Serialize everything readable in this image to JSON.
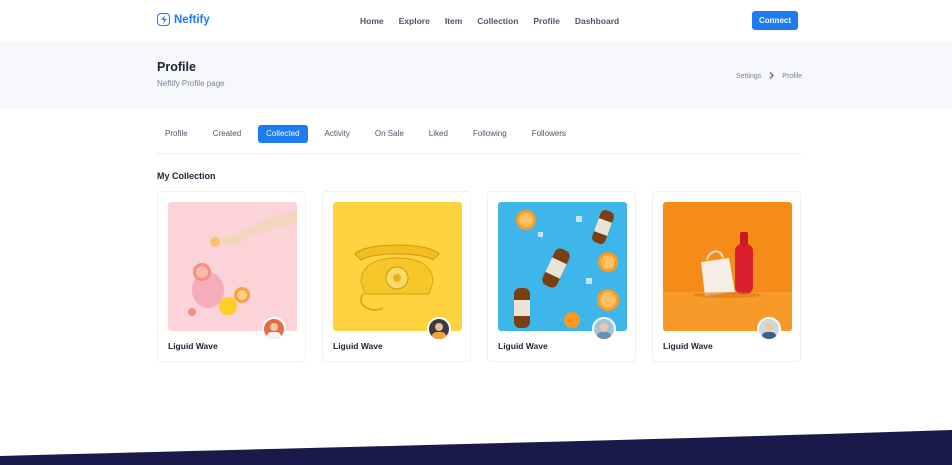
{
  "brand": {
    "name": "Neftify",
    "accent": "#1d7cf2"
  },
  "nav": {
    "links": [
      "Home",
      "Explore",
      "Item",
      "Collection",
      "Profile",
      "Dashboard"
    ],
    "connect_label": "Connect"
  },
  "hero": {
    "title": "Profile",
    "subtitle": "Neftify Profile page",
    "breadcrumb": [
      "Settings",
      "Profile"
    ]
  },
  "tabs": {
    "items": [
      "Profile",
      "Created",
      "Collected",
      "Activity",
      "On Sale",
      "Liked",
      "Following",
      "Followers"
    ],
    "active": "Collected"
  },
  "collection": {
    "title": "My Collection",
    "cards": [
      {
        "title": "Liguid Wave",
        "image": "lemonade-hand-pink",
        "avatar": "user-avatar"
      },
      {
        "title": "Liguid Wave",
        "image": "yellow-telephone",
        "avatar": "user-avatar"
      },
      {
        "title": "Liguid Wave",
        "image": "bottles-oranges-blue",
        "avatar": "user-avatar"
      },
      {
        "title": "Liguid Wave",
        "image": "ketchup-bag-orange",
        "avatar": "user-avatar"
      }
    ]
  },
  "colors": {
    "footer": "#1a1a4a",
    "hero_bg": "#f7f8fb"
  }
}
